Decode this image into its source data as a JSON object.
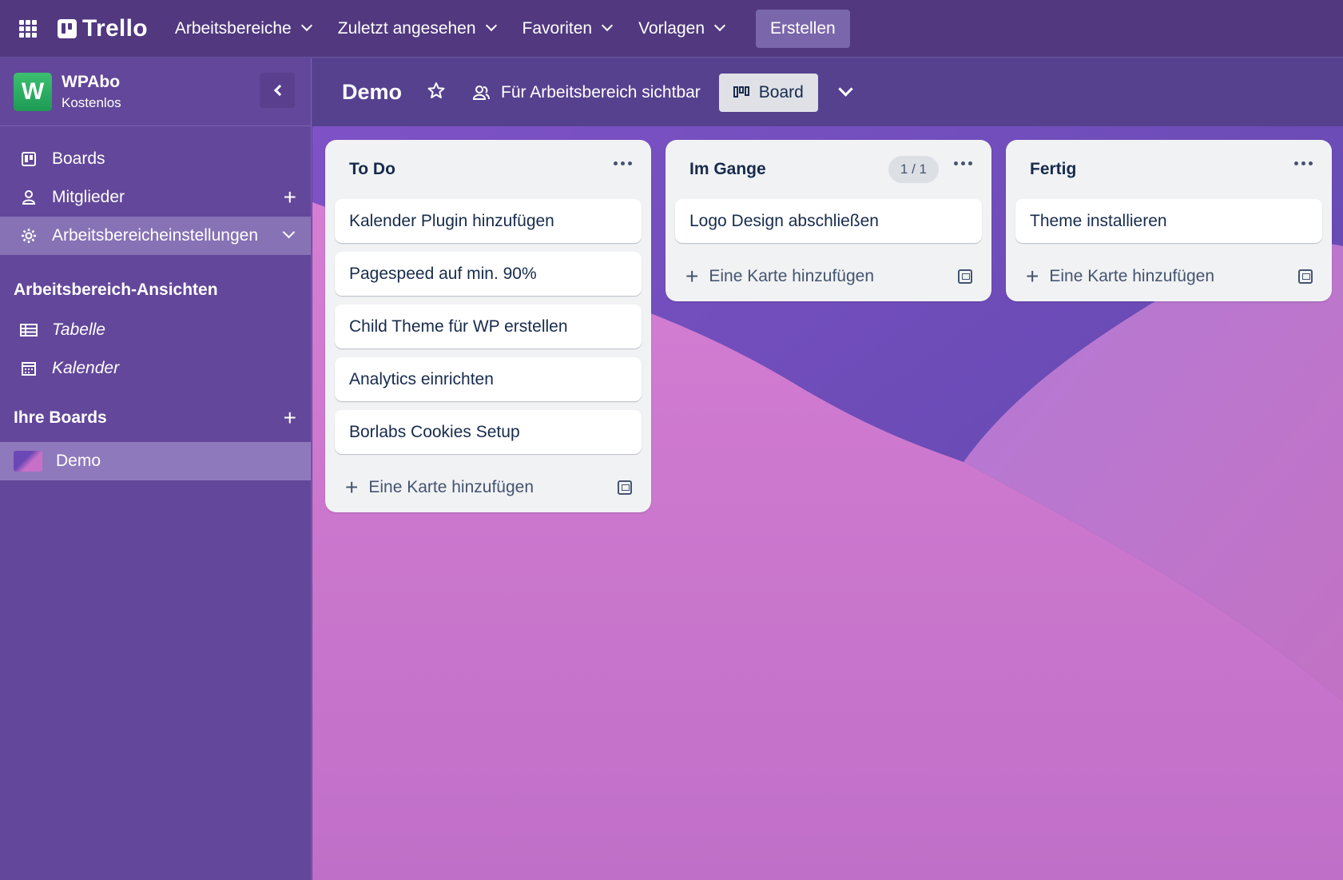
{
  "topbar": {
    "logo_text": "Trello",
    "nav": [
      "Arbeitsbereiche",
      "Zuletzt angesehen",
      "Favoriten",
      "Vorlagen"
    ],
    "create_label": "Erstellen"
  },
  "workspace": {
    "avatar_letter": "W",
    "name": "WPAbo",
    "plan": "Kostenlos"
  },
  "sidebar": {
    "items": [
      {
        "label": "Boards",
        "icon": "board-icon"
      },
      {
        "label": "Mitglieder",
        "icon": "person-icon"
      },
      {
        "label": "Arbeitsbereicheinstellungen",
        "icon": "gear-icon"
      }
    ],
    "views_title": "Arbeitsbereich-Ansichten",
    "views": [
      {
        "label": "Tabelle",
        "icon": "table-icon"
      },
      {
        "label": "Kalender",
        "icon": "calendar-icon"
      }
    ],
    "boards_title": "Ihre Boards",
    "boards": [
      {
        "label": "Demo"
      }
    ]
  },
  "board": {
    "title": "Demo",
    "visibility": "Für Arbeitsbereich sichtbar",
    "view_label": "Board"
  },
  "lists": [
    {
      "title": "To Do",
      "count": "",
      "cards": [
        "Kalender Plugin hinzufügen",
        "Pagespeed auf min. 90%",
        "Child Theme für WP erstellen",
        "Analytics einrichten",
        "Borlabs Cookies Setup"
      ],
      "add_label": "Eine Karte hinzufügen"
    },
    {
      "title": "Im Gange",
      "count": "1 / 1",
      "cards": [
        "Logo Design abschließen"
      ],
      "add_label": "Eine Karte hinzufügen"
    },
    {
      "title": "Fertig",
      "count": "",
      "cards": [
        "Theme installieren"
      ],
      "add_label": "Eine Karte hinzufügen"
    }
  ],
  "colors": {
    "topbar": "#51387f",
    "sidebar": "#63479a",
    "accent_green": "#27ae60",
    "list_bg": "#f1f2f4"
  }
}
